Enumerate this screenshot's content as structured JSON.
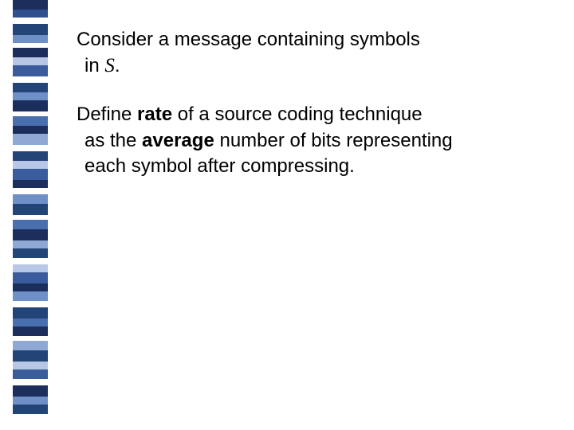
{
  "ribbon": {
    "segments": [
      {
        "color": "#1c2e5c",
        "h": 12
      },
      {
        "color": "#2f4f8f",
        "h": 10
      },
      {
        "color": "#ffffff",
        "h": 8
      },
      {
        "color": "#234477",
        "h": 14
      },
      {
        "color": "#6f8fc7",
        "h": 10
      },
      {
        "color": "#ffffff",
        "h": 6
      },
      {
        "color": "#1c2e5c",
        "h": 12
      },
      {
        "color": "#b9c7e6",
        "h": 10
      },
      {
        "color": "#3a5c9c",
        "h": 14
      },
      {
        "color": "#ffffff",
        "h": 8
      },
      {
        "color": "#234477",
        "h": 12
      },
      {
        "color": "#6f8fc7",
        "h": 10
      },
      {
        "color": "#1c2e5c",
        "h": 14
      },
      {
        "color": "#ffffff",
        "h": 6
      },
      {
        "color": "#4a6fae",
        "h": 12
      },
      {
        "color": "#1c2e5c",
        "h": 10
      },
      {
        "color": "#8fa8d4",
        "h": 14
      },
      {
        "color": "#ffffff",
        "h": 8
      },
      {
        "color": "#234477",
        "h": 12
      },
      {
        "color": "#b9c7e6",
        "h": 10
      },
      {
        "color": "#3a5c9c",
        "h": 14
      },
      {
        "color": "#1c2e5c",
        "h": 10
      },
      {
        "color": "#ffffff",
        "h": 8
      },
      {
        "color": "#6f8fc7",
        "h": 12
      },
      {
        "color": "#234477",
        "h": 14
      },
      {
        "color": "#ffffff",
        "h": 6
      },
      {
        "color": "#4a6fae",
        "h": 12
      },
      {
        "color": "#1c2e5c",
        "h": 14
      },
      {
        "color": "#8fa8d4",
        "h": 10
      },
      {
        "color": "#234477",
        "h": 12
      },
      {
        "color": "#ffffff",
        "h": 8
      },
      {
        "color": "#b9c7e6",
        "h": 10
      },
      {
        "color": "#3a5c9c",
        "h": 14
      },
      {
        "color": "#1c2e5c",
        "h": 10
      },
      {
        "color": "#6f8fc7",
        "h": 12
      },
      {
        "color": "#ffffff",
        "h": 8
      },
      {
        "color": "#234477",
        "h": 14
      },
      {
        "color": "#4a6fae",
        "h": 10
      },
      {
        "color": "#1c2e5c",
        "h": 12
      },
      {
        "color": "#ffffff",
        "h": 6
      },
      {
        "color": "#8fa8d4",
        "h": 12
      },
      {
        "color": "#234477",
        "h": 14
      },
      {
        "color": "#b9c7e6",
        "h": 10
      },
      {
        "color": "#3a5c9c",
        "h": 12
      },
      {
        "color": "#ffffff",
        "h": 8
      },
      {
        "color": "#1c2e5c",
        "h": 14
      },
      {
        "color": "#6f8fc7",
        "h": 10
      },
      {
        "color": "#234477",
        "h": 12
      }
    ]
  },
  "para1": {
    "line1": "Consider a message containing symbols",
    "line2a": "in ",
    "line2b": "S",
    "line2c": "."
  },
  "para2": {
    "line1a": "Define ",
    "line1b": "rate",
    "line1c": " of a source coding technique",
    "line2a": "as the ",
    "line2b": "average",
    "line2c": " number of bits representing",
    "line3": "each symbol after compressing."
  }
}
